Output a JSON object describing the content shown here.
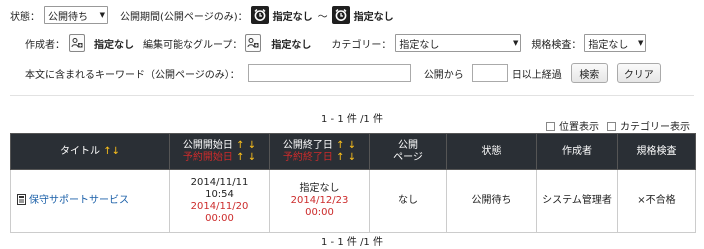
{
  "filters": {
    "status_label": "状態：",
    "status_value": "公開待ち",
    "period_label": "公開期間(公開ページのみ)：",
    "period_from": "指定なし",
    "period_sep": "～",
    "period_to": "指定なし",
    "creator_label": "作成者：",
    "creator_value": "指定なし",
    "group_label": "編集可能なグループ：",
    "group_value": "指定なし",
    "category_label": "カテゴリー：",
    "category_value": "指定なし",
    "spec_label": "規格検査：",
    "spec_value": "指定なし",
    "keyword_label": "本文に含まれるキーワード（公開ページのみ）：",
    "keyword_value": "",
    "since_label": "公開から",
    "days_value": "",
    "days_suffix": "日以上経過",
    "search_button": "検索",
    "clear_button": "クリア"
  },
  "pager_top": "1 - 1 件 /1 件",
  "pager_bottom": "1 - 1 件 /1 件",
  "options": {
    "position_display": "位置表示",
    "category_display": "カテゴリー表示"
  },
  "table": {
    "headers": {
      "title": "タイトル",
      "start": "公開開始日",
      "start_sub": "予約開始日",
      "end": "公開終了日",
      "end_sub": "予約終了日",
      "public_page_1": "公開",
      "public_page_2": "ページ",
      "status": "状態",
      "creator": "作成者",
      "spec": "規格検査"
    },
    "rows": [
      {
        "title": "保守サポートサービス",
        "start_date": "2014/11/11",
        "start_time": "10:54",
        "reserve_start_date": "2014/11/20",
        "reserve_start_time": "00:00",
        "end_value": "指定なし",
        "reserve_end_date": "2014/12/23",
        "reserve_end_time": "00:00",
        "public_page": "なし",
        "status": "公開待ち",
        "creator": "システム管理者",
        "spec": "×不合格"
      }
    ]
  },
  "colors": {
    "header_bg": "#2a2f35",
    "sort_arrow": "#ffc21a",
    "reserved": "#cc2b2b",
    "link": "#1a5fa8"
  }
}
